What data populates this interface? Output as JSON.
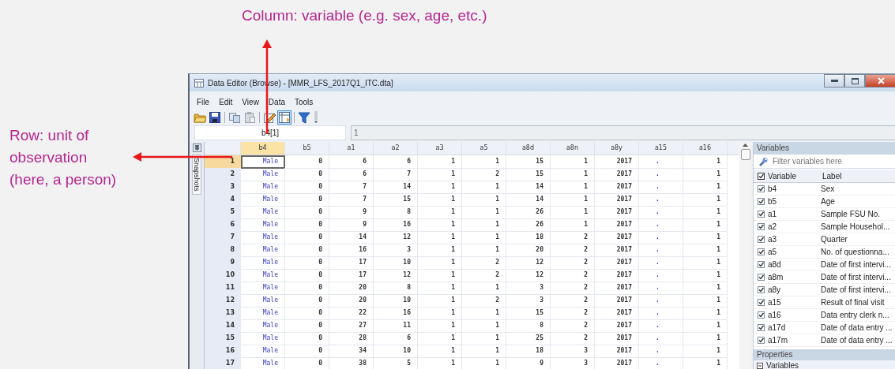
{
  "annotations": [
    {
      "kind": "column",
      "text": "Column: variable (e.g. sex, age, etc.)"
    },
    {
      "kind": "row",
      "text": "Row: unit of observation (here, a person)"
    }
  ],
  "window": {
    "title": "Data Editor (Browse) - [MMR_LFS_2017Q1_ITC.dta]"
  },
  "menu": [
    "File",
    "Edit",
    "View",
    "Data",
    "Tools"
  ],
  "toolbar": [
    {
      "kind": "open",
      "selected": false
    },
    {
      "kind": "save",
      "selected": false
    },
    {
      "kind": "copy",
      "selected": false
    },
    {
      "kind": "paste",
      "selected": false
    },
    {
      "kind": "edit",
      "selected": false
    },
    {
      "kind": "browse",
      "selected": true
    },
    {
      "kind": "filter",
      "selected": false
    },
    {
      "kind": "more",
      "selected": false
    }
  ],
  "cell_name": "b4[1]",
  "cell_value": "1",
  "snapshots_tab": "Snapshots",
  "grid": {
    "columns": [
      {
        "name": "b4",
        "kind": "labeled",
        "selected": true
      },
      {
        "name": "b5",
        "kind": "numeric",
        "selected": false
      },
      {
        "name": "a1",
        "kind": "numeric",
        "selected": false
      },
      {
        "name": "a2",
        "kind": "numeric",
        "selected": false
      },
      {
        "name": "a3",
        "kind": "numeric",
        "selected": false
      },
      {
        "name": "a5",
        "kind": "numeric",
        "selected": false
      },
      {
        "name": "a8d",
        "kind": "numeric",
        "selected": false
      },
      {
        "name": "a8n",
        "kind": "numeric",
        "selected": false
      },
      {
        "name": "a8y",
        "kind": "numeric",
        "selected": false
      },
      {
        "name": "a15",
        "kind": "missing",
        "selected": false
      },
      {
        "name": "a16",
        "kind": "numeric",
        "selected": false
      }
    ],
    "rows": [
      {
        "number": "1",
        "selected": true,
        "cells": [
          "Male",
          "0",
          "6",
          "6",
          "1",
          "1",
          "15",
          "1",
          "2017",
          ".",
          "1"
        ]
      },
      {
        "number": "2",
        "selected": false,
        "cells": [
          "Male",
          "0",
          "6",
          "7",
          "1",
          "2",
          "15",
          "1",
          "2017",
          ".",
          "1"
        ]
      },
      {
        "number": "3",
        "selected": false,
        "cells": [
          "Male",
          "0",
          "7",
          "14",
          "1",
          "1",
          "14",
          "1",
          "2017",
          ".",
          "1"
        ]
      },
      {
        "number": "4",
        "selected": false,
        "cells": [
          "Male",
          "0",
          "7",
          "15",
          "1",
          "1",
          "14",
          "1",
          "2017",
          ".",
          "1"
        ]
      },
      {
        "number": "5",
        "selected": false,
        "cells": [
          "Male",
          "0",
          "9",
          "8",
          "1",
          "1",
          "26",
          "1",
          "2017",
          ".",
          "1"
        ]
      },
      {
        "number": "6",
        "selected": false,
        "cells": [
          "Male",
          "0",
          "9",
          "16",
          "1",
          "1",
          "26",
          "1",
          "2017",
          ".",
          "1"
        ]
      },
      {
        "number": "7",
        "selected": false,
        "cells": [
          "Male",
          "0",
          "14",
          "12",
          "1",
          "1",
          "18",
          "2",
          "2017",
          ".",
          "1"
        ]
      },
      {
        "number": "8",
        "selected": false,
        "cells": [
          "Male",
          "0",
          "16",
          "3",
          "1",
          "1",
          "20",
          "2",
          "2017",
          ".",
          "1"
        ]
      },
      {
        "number": "9",
        "selected": false,
        "cells": [
          "Male",
          "0",
          "17",
          "10",
          "1",
          "2",
          "12",
          "2",
          "2017",
          ".",
          "1"
        ]
      },
      {
        "number": "10",
        "selected": false,
        "cells": [
          "Male",
          "0",
          "17",
          "12",
          "1",
          "2",
          "12",
          "2",
          "2017",
          ".",
          "1"
        ]
      },
      {
        "number": "11",
        "selected": false,
        "cells": [
          "Male",
          "0",
          "20",
          "8",
          "1",
          "1",
          "3",
          "2",
          "2017",
          ".",
          "1"
        ]
      },
      {
        "number": "12",
        "selected": false,
        "cells": [
          "Male",
          "0",
          "20",
          "10",
          "1",
          "2",
          "3",
          "2",
          "2017",
          ".",
          "1"
        ]
      },
      {
        "number": "13",
        "selected": false,
        "cells": [
          "Male",
          "0",
          "22",
          "16",
          "1",
          "1",
          "15",
          "2",
          "2017",
          ".",
          "1"
        ]
      },
      {
        "number": "14",
        "selected": false,
        "cells": [
          "Male",
          "0",
          "27",
          "11",
          "1",
          "1",
          "8",
          "2",
          "2017",
          ".",
          "1"
        ]
      },
      {
        "number": "15",
        "selected": false,
        "cells": [
          "Male",
          "0",
          "28",
          "6",
          "1",
          "1",
          "25",
          "2",
          "2017",
          ".",
          "1"
        ]
      },
      {
        "number": "16",
        "selected": false,
        "cells": [
          "Male",
          "0",
          "34",
          "10",
          "1",
          "1",
          "18",
          "3",
          "2017",
          ".",
          "1"
        ]
      },
      {
        "number": "17",
        "selected": false,
        "cells": [
          "Male",
          "0",
          "38",
          "5",
          "1",
          "1",
          "9",
          "3",
          "2017",
          ".",
          "1"
        ]
      }
    ]
  },
  "variables_panel": {
    "title": "Variables",
    "filter_placeholder": "Filter variables here",
    "columns": [
      "Variable",
      "Label"
    ],
    "all_checked": true,
    "items": [
      {
        "name": "b4",
        "label": "Sex",
        "checked": true
      },
      {
        "name": "b5",
        "label": "Age",
        "checked": true
      },
      {
        "name": "a1",
        "label": "Sample FSU No.",
        "checked": true
      },
      {
        "name": "a2",
        "label": "Sample Househol...",
        "checked": true
      },
      {
        "name": "a3",
        "label": "Quarter",
        "checked": true
      },
      {
        "name": "a5",
        "label": "No. of questionna...",
        "checked": true
      },
      {
        "name": "a8d",
        "label": "Date of first intervi...",
        "checked": true
      },
      {
        "name": "a8m",
        "label": "Date of first intervi...",
        "checked": true
      },
      {
        "name": "a8y",
        "label": "Date of first intervi...",
        "checked": true
      },
      {
        "name": "a15",
        "label": "Result of final visit",
        "checked": true
      },
      {
        "name": "a16",
        "label": "Data entry clerk n...",
        "checked": true
      },
      {
        "name": "a17d",
        "label": "Date of data entry ...",
        "checked": true
      },
      {
        "name": "a17m",
        "label": "Date of data entry ...",
        "checked": true
      }
    ]
  },
  "properties_panel": {
    "title": "Properties",
    "section": "Variables",
    "expanded": true
  }
}
